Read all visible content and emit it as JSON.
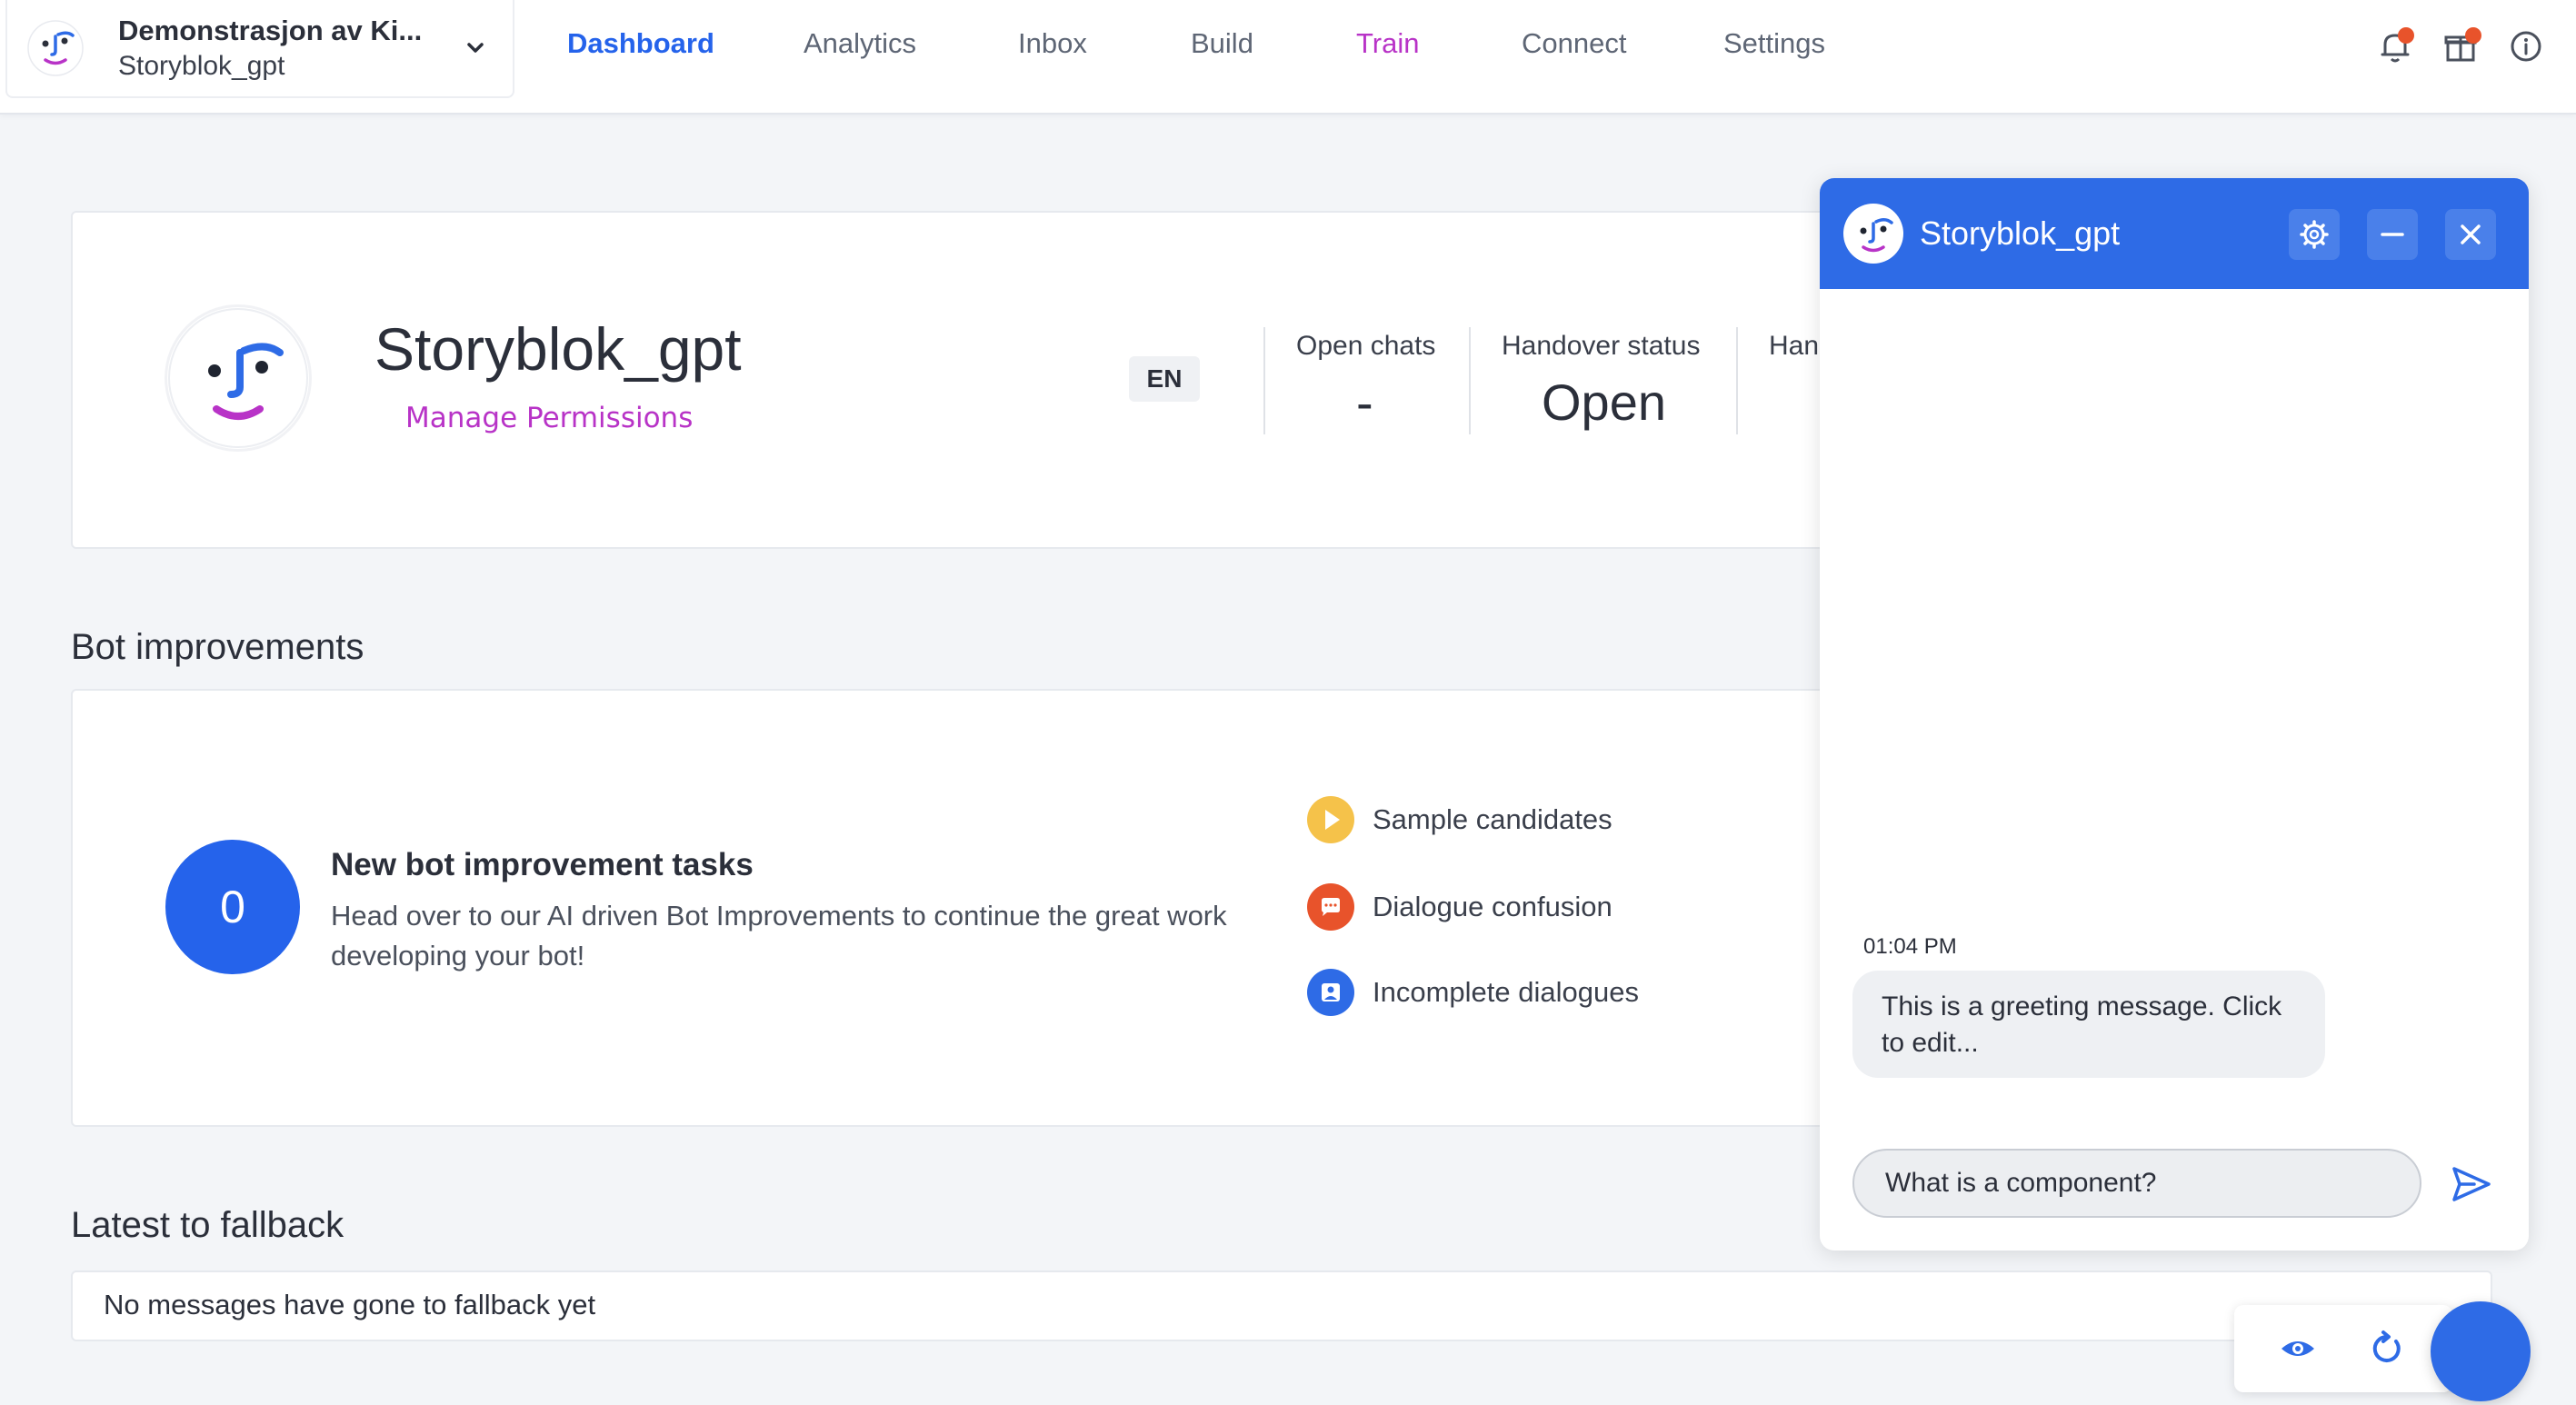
{
  "app": {
    "org_name": "Demonstrasjon av Ki...",
    "bot_name": "Storyblok_gpt"
  },
  "nav": {
    "items": [
      {
        "label": "Dashboard",
        "state": "active"
      },
      {
        "label": "Analytics"
      },
      {
        "label": "Inbox"
      },
      {
        "label": "Build"
      },
      {
        "label": "Train"
      },
      {
        "label": "Connect"
      },
      {
        "label": "Settings"
      }
    ]
  },
  "top_icons": [
    "bell-icon",
    "gift-icon",
    "info-icon"
  ],
  "profile": {
    "title": "Storyblok_gpt",
    "manage_permissions": "Manage Permissions",
    "language": "EN",
    "stats": [
      {
        "label": "Open chats",
        "value": "-"
      },
      {
        "label": "Handover status",
        "value": "Open"
      },
      {
        "label": "Han",
        "value": ""
      }
    ]
  },
  "improvements": {
    "section_title": "Bot improvements",
    "count": "0",
    "heading": "New bot improvement tasks",
    "description": "Head over to our AI driven Bot Improvements to continue the great work developing your bot!",
    "categories": [
      {
        "label": "Sample candidates",
        "color": "#f5c24a",
        "icon": "play-icon"
      },
      {
        "label": "Dialogue confusion",
        "color": "#e8532b",
        "icon": "chat-icon"
      },
      {
        "label": "Incomplete dialogues",
        "color": "#2e6be6",
        "icon": "person-icon"
      }
    ]
  },
  "fallback": {
    "section_title": "Latest to fallback",
    "empty_text": "No messages have gone to fallback yet"
  },
  "chat": {
    "title": "Storyblok_gpt",
    "time": "01:04 PM",
    "message": "This is a greeting message. Click to edit...",
    "input_value": "What is a component?"
  },
  "colors": {
    "accent": "#2563eb",
    "chat_header": "#2e6be6",
    "train": "#b833c7",
    "notification": "#e8532b"
  }
}
